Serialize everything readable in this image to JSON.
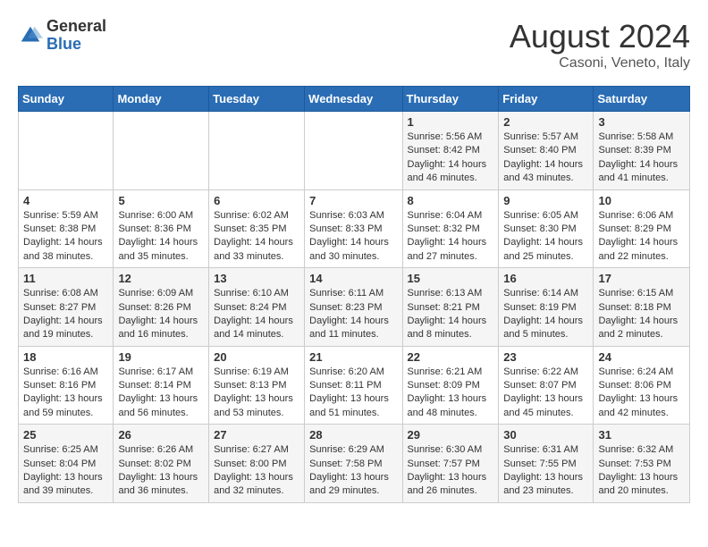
{
  "header": {
    "logo_general": "General",
    "logo_blue": "Blue",
    "month_year": "August 2024",
    "location": "Casoni, Veneto, Italy"
  },
  "calendar": {
    "days_of_week": [
      "Sunday",
      "Monday",
      "Tuesday",
      "Wednesday",
      "Thursday",
      "Friday",
      "Saturday"
    ],
    "weeks": [
      [
        {
          "day": "",
          "info": ""
        },
        {
          "day": "",
          "info": ""
        },
        {
          "day": "",
          "info": ""
        },
        {
          "day": "",
          "info": ""
        },
        {
          "day": "1",
          "info": "Sunrise: 5:56 AM\nSunset: 8:42 PM\nDaylight: 14 hours and 46 minutes."
        },
        {
          "day": "2",
          "info": "Sunrise: 5:57 AM\nSunset: 8:40 PM\nDaylight: 14 hours and 43 minutes."
        },
        {
          "day": "3",
          "info": "Sunrise: 5:58 AM\nSunset: 8:39 PM\nDaylight: 14 hours and 41 minutes."
        }
      ],
      [
        {
          "day": "4",
          "info": "Sunrise: 5:59 AM\nSunset: 8:38 PM\nDaylight: 14 hours and 38 minutes."
        },
        {
          "day": "5",
          "info": "Sunrise: 6:00 AM\nSunset: 8:36 PM\nDaylight: 14 hours and 35 minutes."
        },
        {
          "day": "6",
          "info": "Sunrise: 6:02 AM\nSunset: 8:35 PM\nDaylight: 14 hours and 33 minutes."
        },
        {
          "day": "7",
          "info": "Sunrise: 6:03 AM\nSunset: 8:33 PM\nDaylight: 14 hours and 30 minutes."
        },
        {
          "day": "8",
          "info": "Sunrise: 6:04 AM\nSunset: 8:32 PM\nDaylight: 14 hours and 27 minutes."
        },
        {
          "day": "9",
          "info": "Sunrise: 6:05 AM\nSunset: 8:30 PM\nDaylight: 14 hours and 25 minutes."
        },
        {
          "day": "10",
          "info": "Sunrise: 6:06 AM\nSunset: 8:29 PM\nDaylight: 14 hours and 22 minutes."
        }
      ],
      [
        {
          "day": "11",
          "info": "Sunrise: 6:08 AM\nSunset: 8:27 PM\nDaylight: 14 hours and 19 minutes."
        },
        {
          "day": "12",
          "info": "Sunrise: 6:09 AM\nSunset: 8:26 PM\nDaylight: 14 hours and 16 minutes."
        },
        {
          "day": "13",
          "info": "Sunrise: 6:10 AM\nSunset: 8:24 PM\nDaylight: 14 hours and 14 minutes."
        },
        {
          "day": "14",
          "info": "Sunrise: 6:11 AM\nSunset: 8:23 PM\nDaylight: 14 hours and 11 minutes."
        },
        {
          "day": "15",
          "info": "Sunrise: 6:13 AM\nSunset: 8:21 PM\nDaylight: 14 hours and 8 minutes."
        },
        {
          "day": "16",
          "info": "Sunrise: 6:14 AM\nSunset: 8:19 PM\nDaylight: 14 hours and 5 minutes."
        },
        {
          "day": "17",
          "info": "Sunrise: 6:15 AM\nSunset: 8:18 PM\nDaylight: 14 hours and 2 minutes."
        }
      ],
      [
        {
          "day": "18",
          "info": "Sunrise: 6:16 AM\nSunset: 8:16 PM\nDaylight: 13 hours and 59 minutes."
        },
        {
          "day": "19",
          "info": "Sunrise: 6:17 AM\nSunset: 8:14 PM\nDaylight: 13 hours and 56 minutes."
        },
        {
          "day": "20",
          "info": "Sunrise: 6:19 AM\nSunset: 8:13 PM\nDaylight: 13 hours and 53 minutes."
        },
        {
          "day": "21",
          "info": "Sunrise: 6:20 AM\nSunset: 8:11 PM\nDaylight: 13 hours and 51 minutes."
        },
        {
          "day": "22",
          "info": "Sunrise: 6:21 AM\nSunset: 8:09 PM\nDaylight: 13 hours and 48 minutes."
        },
        {
          "day": "23",
          "info": "Sunrise: 6:22 AM\nSunset: 8:07 PM\nDaylight: 13 hours and 45 minutes."
        },
        {
          "day": "24",
          "info": "Sunrise: 6:24 AM\nSunset: 8:06 PM\nDaylight: 13 hours and 42 minutes."
        }
      ],
      [
        {
          "day": "25",
          "info": "Sunrise: 6:25 AM\nSunset: 8:04 PM\nDaylight: 13 hours and 39 minutes."
        },
        {
          "day": "26",
          "info": "Sunrise: 6:26 AM\nSunset: 8:02 PM\nDaylight: 13 hours and 36 minutes."
        },
        {
          "day": "27",
          "info": "Sunrise: 6:27 AM\nSunset: 8:00 PM\nDaylight: 13 hours and 32 minutes."
        },
        {
          "day": "28",
          "info": "Sunrise: 6:29 AM\nSunset: 7:58 PM\nDaylight: 13 hours and 29 minutes."
        },
        {
          "day": "29",
          "info": "Sunrise: 6:30 AM\nSunset: 7:57 PM\nDaylight: 13 hours and 26 minutes."
        },
        {
          "day": "30",
          "info": "Sunrise: 6:31 AM\nSunset: 7:55 PM\nDaylight: 13 hours and 23 minutes."
        },
        {
          "day": "31",
          "info": "Sunrise: 6:32 AM\nSunset: 7:53 PM\nDaylight: 13 hours and 20 minutes."
        }
      ]
    ]
  }
}
